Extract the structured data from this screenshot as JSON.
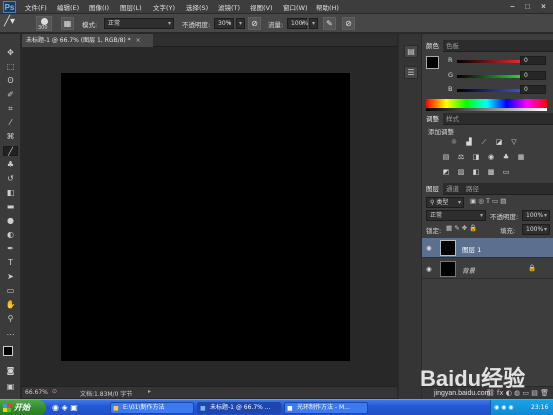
{
  "menubar": {
    "logo": "Ps",
    "items": [
      "文件(F)",
      "编辑(E)",
      "图像(I)",
      "图层(L)",
      "文字(Y)",
      "选择(S)",
      "滤镜(T)",
      "视图(V)",
      "窗口(W)",
      "帮助(H)"
    ]
  },
  "options": {
    "brush_size": "300",
    "mode_label": "模式:",
    "mode_value": "正常",
    "opacity_label": "不透明度:",
    "opacity_value": "30%",
    "flow_label": "流量:",
    "flow_value": "100%"
  },
  "document": {
    "tab_title": "未标题-1 @ 66.7% (图层 1, RGB/8) *",
    "zoom": "66.67%",
    "doc_info": "文档:1.83M/0 字节"
  },
  "color_panel": {
    "tabs": [
      "颜色",
      "色板"
    ],
    "channels": [
      {
        "label": "R",
        "value": "0",
        "color": "#d23a3a"
      },
      {
        "label": "G",
        "value": "0",
        "color": "#2ca12c"
      },
      {
        "label": "B",
        "value": "0",
        "color": "#3a5ad6"
      }
    ]
  },
  "adjust_panel": {
    "tabs": [
      "调整",
      "样式"
    ],
    "heading": "添加调整"
  },
  "layers_panel": {
    "tabs": [
      "图层",
      "通道",
      "路径"
    ],
    "kind_label": "类型",
    "blend_mode": "正常",
    "opacity_label": "不透明度:",
    "opacity_value": "100%",
    "lock_label": "锁定:",
    "fill_label": "填充:",
    "fill_value": "100%",
    "layers": [
      {
        "name": "图层 1",
        "selected": true
      },
      {
        "name": "背景",
        "selected": false,
        "locked": true
      }
    ]
  },
  "taskbar": {
    "start": "开始",
    "tasks": [
      "E:\\01\\制作方法",
      "未标题-1 @ 66.7% ...",
      "光环制作方法 - M..."
    ],
    "clock": "23:16"
  },
  "watermark": {
    "text": "Baidu经验",
    "sub": "jingyan.baidu.com"
  },
  "colors": {
    "accent": "#2358d6",
    "canvas": "#000000",
    "selected_layer": "#5b6f8f"
  }
}
